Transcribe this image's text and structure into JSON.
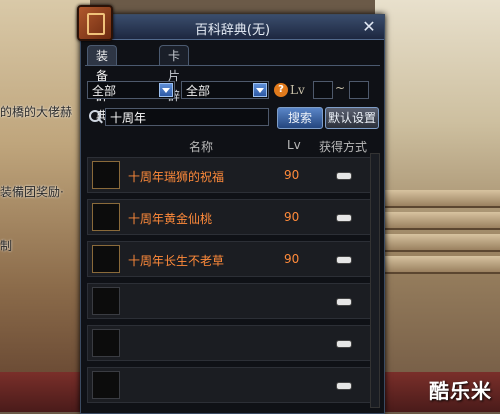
{
  "window": {
    "title": "百科辞典(无)",
    "close_glyph": "✕"
  },
  "tabs": [
    {
      "label": "装备辞典",
      "active": true
    },
    {
      "label": "卡片辞典",
      "active": false
    }
  ],
  "filters": {
    "select1": "全部",
    "select2": "全部",
    "lv_label": "Lv",
    "lv_separator": "~",
    "help_glyph": "?"
  },
  "search": {
    "value": "十周年",
    "button": "搜索",
    "reset_button": "默认设置"
  },
  "table": {
    "headers": {
      "name": "名称",
      "lv": "Lv",
      "source": "获得方式"
    },
    "rows": [
      {
        "name": "十周年瑞狮的祝福",
        "lv": "90"
      },
      {
        "name": "十周年黄金仙桃",
        "lv": "90"
      },
      {
        "name": "十周年长生不老草",
        "lv": "90"
      },
      {
        "name": "",
        "lv": ""
      },
      {
        "name": "",
        "lv": ""
      },
      {
        "name": "",
        "lv": ""
      }
    ]
  },
  "scene": {
    "text1": "的橋的大佬赫",
    "text2": "装備团奖励·",
    "text3": "制",
    "watermark": "酷乐米"
  },
  "colors": {
    "item_name": "#ff8a3a",
    "title_bar": "#2a3a58",
    "accent_blue": "#3a6bb5"
  }
}
